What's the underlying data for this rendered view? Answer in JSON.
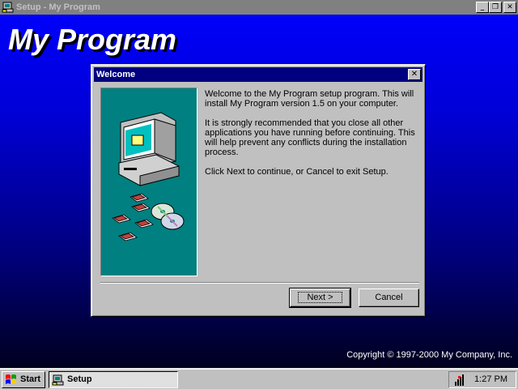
{
  "window": {
    "title": "Setup - My Program",
    "big_title": "My Program",
    "copyright": "Copyright © 1997-2000 My Company, Inc.",
    "controls": {
      "minimize": "_",
      "restore": "❐",
      "close": "✕"
    }
  },
  "dialog": {
    "title": "Welcome",
    "close_symbol": "✕",
    "paragraphs": [
      "Welcome to the My Program setup program. This will install My Program version 1.5 on your computer.",
      "It is strongly recommended that you close all other applications you have running before continuing. This will help prevent any conflicts during the installation process.",
      "Click Next to continue, or Cancel to exit Setup."
    ],
    "next_label": "Next >",
    "cancel_label": "Cancel"
  },
  "taskbar": {
    "start_label": "Start",
    "task_label": "Setup",
    "clock": "1:27 PM"
  },
  "colors": {
    "desktop_gradient_top": "#0000ff",
    "desktop_gradient_bottom": "#00001e",
    "dialog_title_bar": "#000080",
    "side_panel": "#008080",
    "face": "#c0c0c0"
  },
  "icons": [
    "setup-app-icon",
    "computer-disks-illustration",
    "windows-logo-icon",
    "volume-icon"
  ]
}
